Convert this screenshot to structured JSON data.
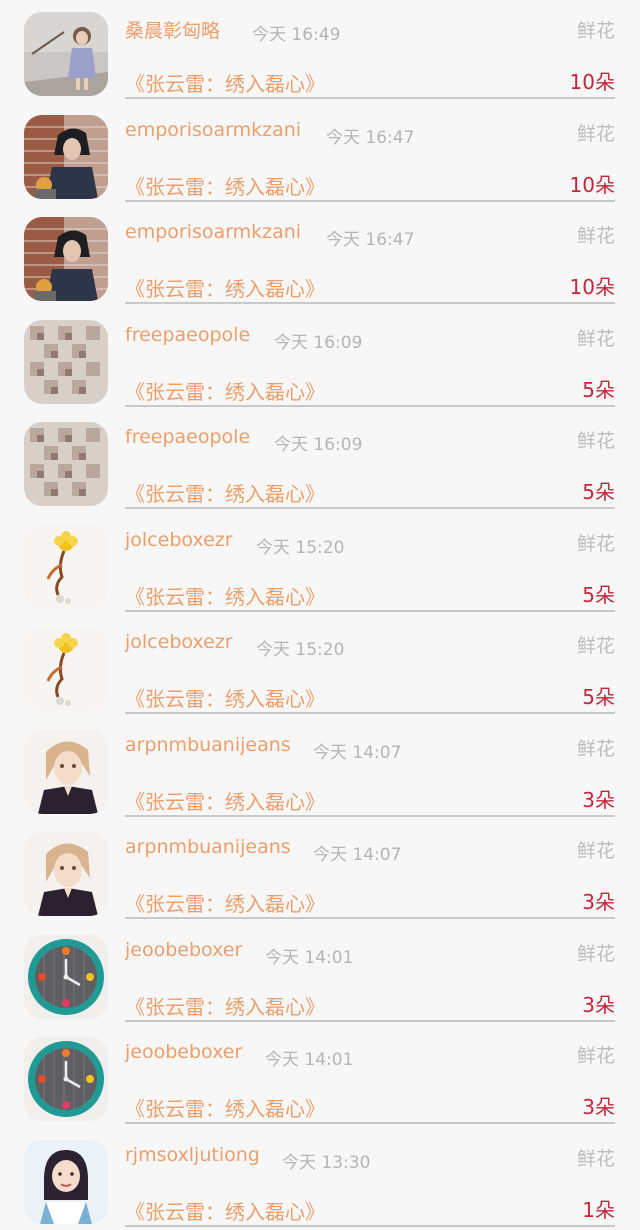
{
  "gifts": [
    {
      "name": "桑晨彰匈略",
      "time": "今天 16:49",
      "gift_type": "鲜花",
      "work_title": "《张云雷：绣入磊心》",
      "amount": "10朵",
      "avatar": "girl-photo"
    },
    {
      "name": "emporisoarmkzani",
      "time": "今天 16:47",
      "gift_type": "鲜花",
      "work_title": "《张云雷：绣入磊心》",
      "amount": "10朵",
      "avatar": "brick-portrait"
    },
    {
      "name": "emporisoarmkzani",
      "time": "今天 16:47",
      "gift_type": "鲜花",
      "work_title": "《张云雷：绣入磊心》",
      "amount": "10朵",
      "avatar": "brick-portrait"
    },
    {
      "name": "freepaeopole",
      "time": "今天 16:09",
      "gift_type": "鲜花",
      "work_title": "《张云雷：绣入磊心》",
      "amount": "5朵",
      "avatar": "cube-pattern"
    },
    {
      "name": "freepaeopole",
      "time": "今天 16:09",
      "gift_type": "鲜花",
      "work_title": "《张云雷：绣入磊心》",
      "amount": "5朵",
      "avatar": "cube-pattern"
    },
    {
      "name": "jolceboxezr",
      "time": "今天 15:20",
      "gift_type": "鲜花",
      "work_title": "《张云雷：绣入磊心》",
      "amount": "5朵",
      "avatar": "flower-drawing"
    },
    {
      "name": "jolceboxezr",
      "time": "今天 15:20",
      "gift_type": "鲜花",
      "work_title": "《张云雷：绣入磊心》",
      "amount": "5朵",
      "avatar": "flower-drawing"
    },
    {
      "name": "arpnmbuanijeans",
      "time": "今天 14:07",
      "gift_type": "鲜花",
      "work_title": "《张云雷：绣入磊心》",
      "amount": "3朵",
      "avatar": "anime-portrait"
    },
    {
      "name": "arpnmbuanijeans",
      "time": "今天 14:07",
      "gift_type": "鲜花",
      "work_title": "《张云雷：绣入磊心》",
      "amount": "3朵",
      "avatar": "anime-portrait"
    },
    {
      "name": "jeoobeboxer",
      "time": "今天 14:01",
      "gift_type": "鲜花",
      "work_title": "《张云雷：绣入磊心》",
      "amount": "3朵",
      "avatar": "wall-clock"
    },
    {
      "name": "jeoobeboxer",
      "time": "今天 14:01",
      "gift_type": "鲜花",
      "work_title": "《张云雷：绣入磊心》",
      "amount": "3朵",
      "avatar": "wall-clock"
    },
    {
      "name": "rjmsoxljutiong",
      "time": "今天 13:30",
      "gift_type": "鲜花",
      "work_title": "《张云雷：绣入磊心》",
      "amount": "1朵",
      "avatar": "woman-portrait"
    }
  ],
  "colors": {
    "name": "#ec9f6c",
    "time": "#b5b5b5",
    "amount": "#c2273a",
    "background": "#f7f7f7"
  }
}
